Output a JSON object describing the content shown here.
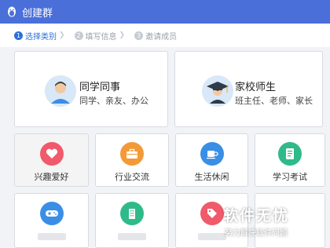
{
  "window": {
    "title": "创建群"
  },
  "steps": [
    {
      "num": "1",
      "label": "选择类别",
      "active": true
    },
    {
      "num": "2",
      "label": "填写信息",
      "active": false
    },
    {
      "num": "3",
      "label": "邀请成员",
      "active": false
    }
  ],
  "big_cards": [
    {
      "title": "同学同事",
      "subtitle": "同学、亲友、办公",
      "icon": "person-icon"
    },
    {
      "title": "家校师生",
      "subtitle": "班主任、老师、家长",
      "icon": "graduation-cap-icon"
    }
  ],
  "categories": [
    {
      "label": "兴趣爱好",
      "icon": "heart-icon",
      "color": "#f05a6a"
    },
    {
      "label": "行业交流",
      "icon": "briefcase-icon",
      "color": "#f29a38"
    },
    {
      "label": "生活休闲",
      "icon": "cup-icon",
      "color": "#3a8ee6"
    },
    {
      "label": "学习考试",
      "icon": "book-icon",
      "color": "#2fba8a"
    }
  ],
  "categories_row2": [
    {
      "icon": "gamepad-icon",
      "color": "#3a8ee6"
    },
    {
      "icon": "building-icon",
      "color": "#2fba8a"
    },
    {
      "icon": "tag-icon",
      "color": "#f05a6a"
    }
  ],
  "watermark": {
    "main": "软件无忧",
    "sub": "努力解决软件问题"
  },
  "colors": {
    "titlebar": "#4a6fd9",
    "accent": "#2d6fd8"
  }
}
